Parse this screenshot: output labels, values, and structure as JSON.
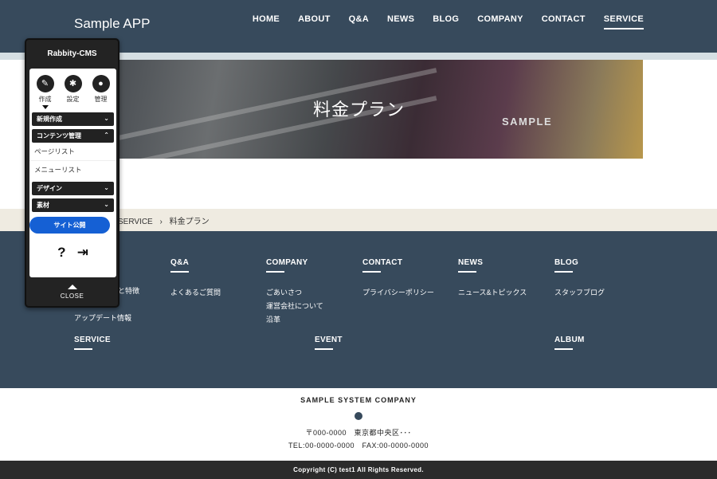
{
  "header": {
    "logo": "Sample APP",
    "nav": [
      "HOME",
      "ABOUT",
      "Q&A",
      "NEWS",
      "BLOG",
      "COMPANY",
      "CONTACT",
      "SERVICE"
    ],
    "active": "SERVICE"
  },
  "hero": {
    "title": "料金プラン",
    "subtitle": "SAMPLE"
  },
  "breadcrumb": {
    "items": [
      "SERVICE",
      "料金プラン"
    ],
    "separator": "›"
  },
  "footer": {
    "columns": [
      {
        "title": "",
        "items": [
          "と特徴",
          "",
          "アップデート情報"
        ]
      },
      {
        "title": "Q&A",
        "items": [
          "よくあるご質問"
        ]
      },
      {
        "title": "COMPANY",
        "items": [
          "ごあいさつ",
          "運営会社について",
          "沿革"
        ]
      },
      {
        "title": "CONTACT",
        "items": [
          "プライバシーポリシー"
        ]
      },
      {
        "title": "NEWS",
        "items": [
          "ニュース&トピックス"
        ]
      },
      {
        "title": "BLOG",
        "items": [
          "スタッフブログ"
        ]
      },
      {
        "title": "SERVICE",
        "items": []
      },
      {
        "title": "EVENT",
        "items": []
      },
      {
        "title": "ALBUM",
        "items": []
      }
    ]
  },
  "company": {
    "name": "SAMPLE SYSTEM COMPANY",
    "address": "〒000-0000　東京都中央区･･･",
    "tel": "TEL:00-0000-0000　FAX:00-0000-0000"
  },
  "copyright": "Copyright (C) test1 All Rights Reserved.",
  "cms": {
    "title": "Rabbity-CMS",
    "icons": [
      {
        "label": "作成",
        "icon": "pen-icon"
      },
      {
        "label": "設定",
        "icon": "gear-icon"
      },
      {
        "label": "管理",
        "icon": "user-icon"
      }
    ],
    "new": "新規作成",
    "contents": "コンテンツ管理",
    "page_list": "ページリスト",
    "menu_list": "メニューリスト",
    "design": "デザイン",
    "material": "素材",
    "publish": "サイト公開",
    "help": "?",
    "close": "CLOSE"
  },
  "colors": {
    "header": "#374a5c",
    "publish": "#1560d4",
    "breadcrumb_bg": "#efebe1"
  }
}
